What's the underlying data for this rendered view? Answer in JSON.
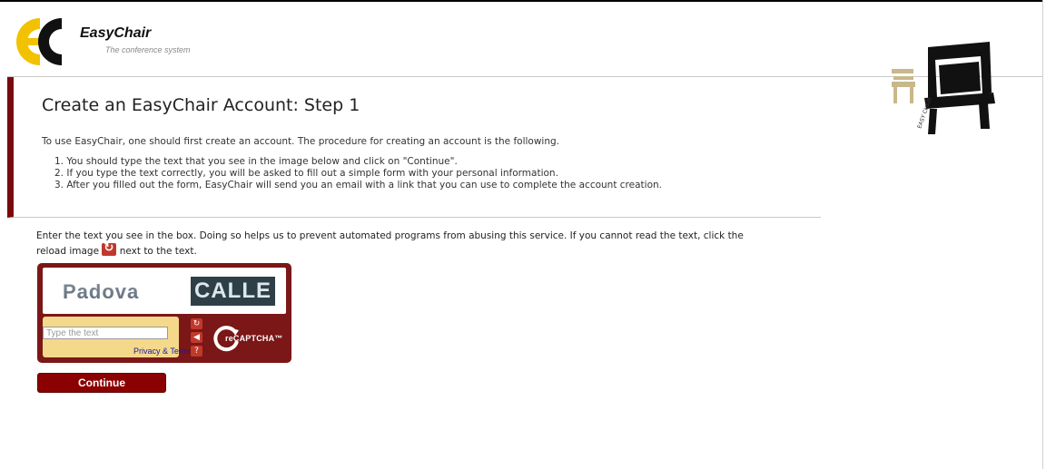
{
  "brand": {
    "name": "EasyChair",
    "tagline": "The conference system"
  },
  "page": {
    "title": "Create an EasyChair Account: Step 1",
    "intro": "To use EasyChair, one should first create an account. The procedure for creating an account is the following.",
    "steps": [
      "1. You should type the text that you see in the image below and click on \"Continue\".",
      "2. If you type the text correctly, you will be asked to fill out a simple form with your personal information.",
      "3. After you filled out the form, EasyChair will send you an email with a link that you can use to complete the account creation."
    ],
    "instruction_part1": "Enter the text you see in the box. Doing so helps us to prevent automated programs from abusing this service. If you cannot read the text, click the reload image",
    "instruction_part2": "next to the text."
  },
  "captcha": {
    "word1": "Padova",
    "word2": "CALLE",
    "placeholder": "Type the text",
    "privacy_link": "Privacy & Terms",
    "logo_text": "reCAPTCHA™",
    "buttons": [
      "reload-icon",
      "audio-icon",
      "help-icon"
    ]
  },
  "actions": {
    "continue_label": "Continue"
  },
  "colors": {
    "accent": "#7a0a0a",
    "captcha_bg": "#7b1717",
    "captcha_input_bg": "#f5d98b",
    "logo_yellow": "#f2c200"
  }
}
